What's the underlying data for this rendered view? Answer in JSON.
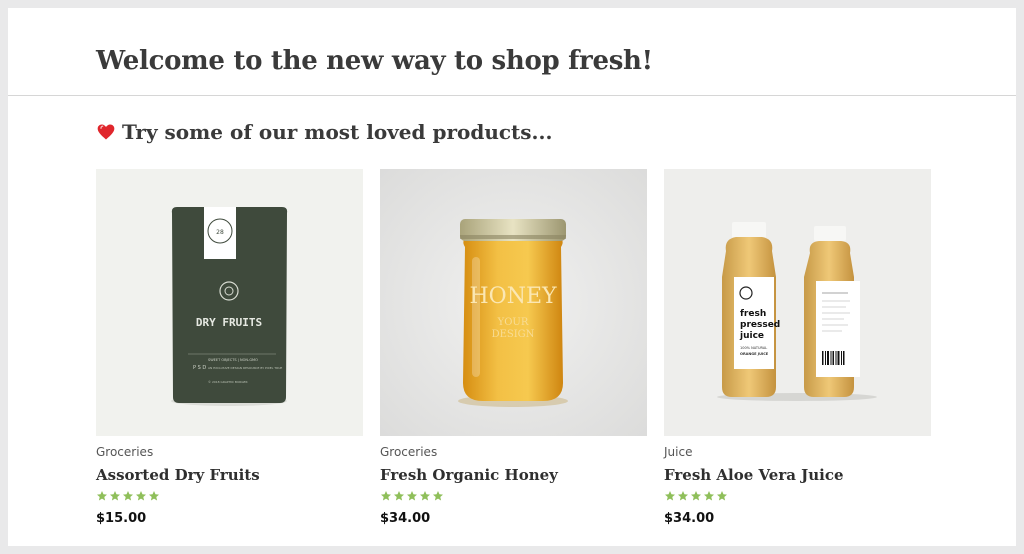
{
  "page": {
    "heading": "Welcome to the new way to shop fresh!",
    "section_heading": "Try some of our most loved products...",
    "section_icon": "heart-icon"
  },
  "colors": {
    "star": "#8fbf5a",
    "heart": "#e0262c"
  },
  "products": [
    {
      "category": "Groceries",
      "name": "Assorted Dry Fruits",
      "rating": 5,
      "price": "$15.00",
      "image": {
        "kind": "pouch",
        "label": "DRY FRUITS",
        "side_letters": "P S D",
        "text_right": "SWEET OBJECTS | NON-GMO",
        "text_sub": "AN EXCLUSIVE DESIGN RESOURCE BY PIXEL TRUE",
        "text_foot": "© 2018 GRAPHIC BURGER",
        "seal_text": "ORGANIC FOOD"
      }
    },
    {
      "category": "Groceries",
      "name": "Fresh Organic Honey",
      "rating": 5,
      "price": "$34.00",
      "image": {
        "kind": "jar",
        "label": "HONEY",
        "sublabel_1": "YOUR",
        "sublabel_2": "DESIGN"
      }
    },
    {
      "category": "Juice",
      "name": "Fresh Aloe Vera Juice",
      "rating": 5,
      "price": "$34.00",
      "image": {
        "kind": "bottles",
        "label_line1": "fresh",
        "label_line2": "pressed",
        "label_line3": "juice",
        "label_note": "100% NATURAL",
        "label_flavor": "ORANGE JUICE"
      }
    }
  ]
}
